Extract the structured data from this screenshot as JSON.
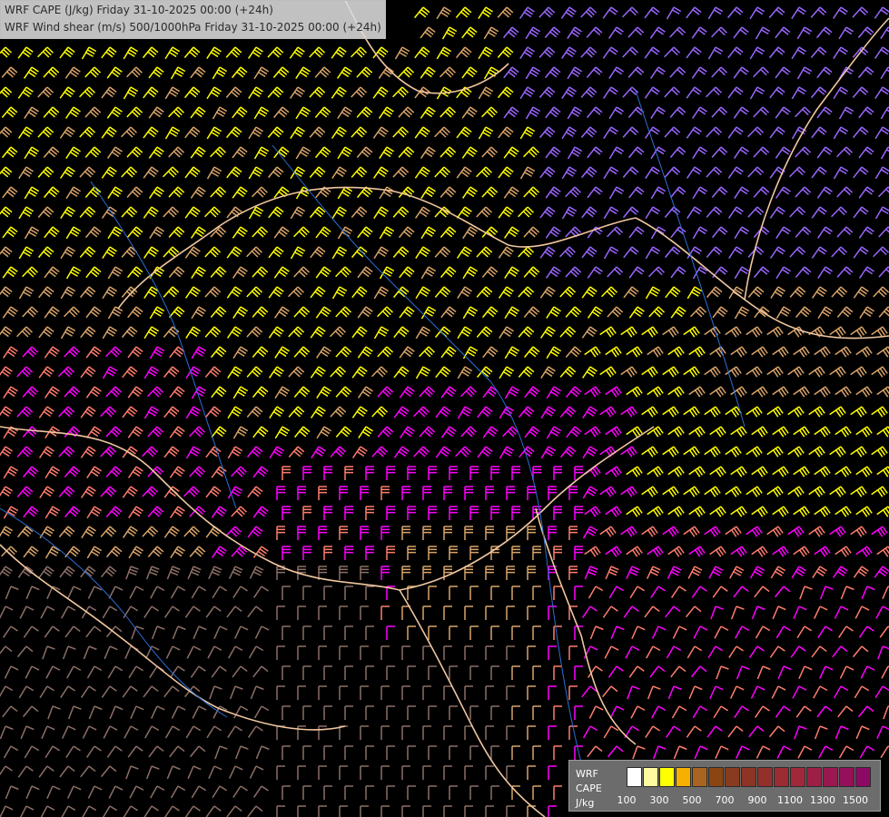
{
  "title": {
    "line1": "WRF CAPE (J/kg) Friday 31-10-2025 00:00 (+24h)",
    "line2": "WRF Wind shear (m/s) 500/1000hPa Friday 31-10-2025 00:00 (+24h)"
  },
  "legend": {
    "line1": "WRF",
    "line2": "CAPE",
    "line3": "J/kg",
    "colors": [
      "#ffffff",
      "#fffa9d",
      "#ffff00",
      "#f5b000",
      "#a86420",
      "#8b4513",
      "#8a3a1e",
      "#8e3424",
      "#94302a",
      "#9a2c32",
      "#a0283a",
      "#9e1f45",
      "#9a1850",
      "#94105a",
      "#8c0a64"
    ],
    "ticks": [
      "100",
      "300",
      "500",
      "700",
      "900",
      "1100",
      "1300",
      "1500"
    ]
  },
  "map_style": {
    "yellow": "#ffff00",
    "tan": "#d9a46a",
    "salmon": "#ff7d6e",
    "magenta": "#ff00ff",
    "violet": "#9a66ff",
    "grey_brown": "#8c6f66",
    "border": "#f0c6a0",
    "river": "#2b6fd6"
  }
}
